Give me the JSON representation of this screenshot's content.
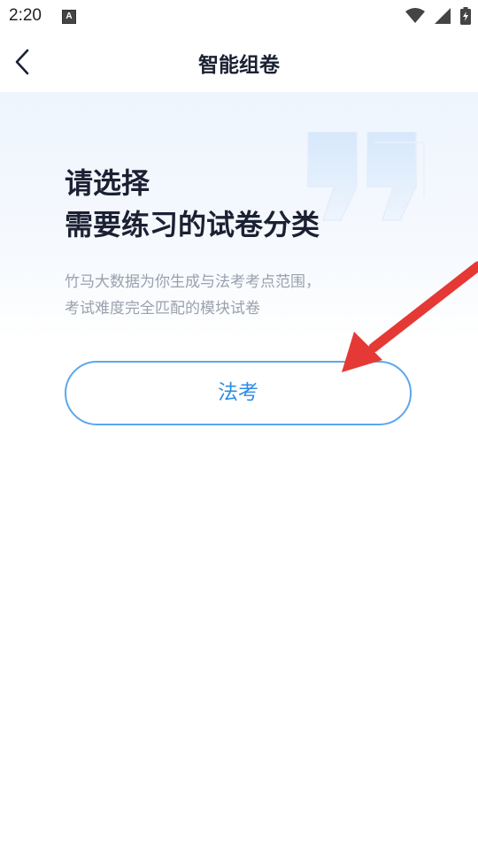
{
  "status_bar": {
    "time": "2:20",
    "notification_icon": "A",
    "icons": [
      "wifi-icon",
      "signal-icon",
      "battery-charging-icon"
    ]
  },
  "nav": {
    "title": "智能组卷",
    "back_icon": "chevron-left-icon"
  },
  "hero": {
    "headline_line1": "请选择",
    "headline_line2": "需要练习的试卷分类",
    "subtitle_line1": "竹马大数据为你生成与法考考点范围，",
    "subtitle_line2": "考试难度完全匹配的模块试卷",
    "decoration": "quote-mark-icon"
  },
  "categories": [
    {
      "label": "法考"
    }
  ],
  "colors": {
    "accent": "#2d8de6",
    "button_border": "#5aa7ee",
    "arrow": "#e53935",
    "text_primary": "#1b2133",
    "text_secondary": "#9aa1ae"
  }
}
